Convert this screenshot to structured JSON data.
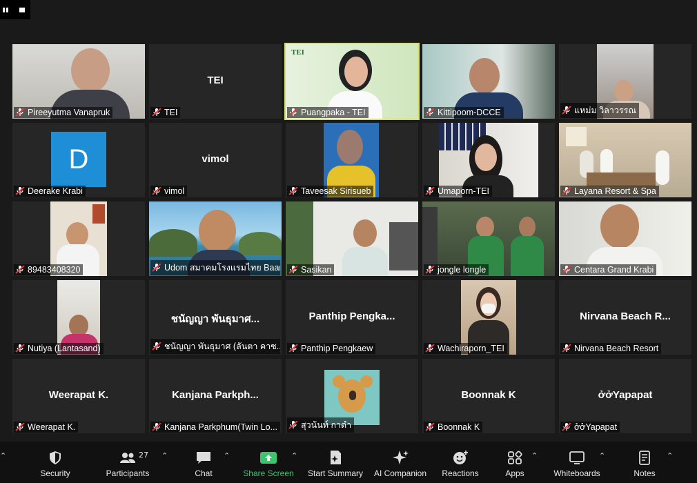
{
  "meeting": {
    "participants_count": "27"
  },
  "tiles": [
    {
      "name": "Pireeyutma Vanapruk",
      "big": "",
      "kind": "video-man-gray"
    },
    {
      "name": "TEI",
      "big": "TEI",
      "kind": "name"
    },
    {
      "name": "Puangpaka - TEI",
      "big": "",
      "kind": "video-green",
      "active": true
    },
    {
      "name": "Kittipoom-DCCE",
      "big": "",
      "kind": "video-office"
    },
    {
      "name": "แหม่ม วิลาวรรณ",
      "big": "",
      "kind": "video-room"
    },
    {
      "name": "Deerake Krabi",
      "big": "",
      "kind": "avatar"
    },
    {
      "name": "vimol",
      "big": "vimol",
      "kind": "name"
    },
    {
      "name": "Taveesak Sirisueb",
      "big": "",
      "kind": "video-blue"
    },
    {
      "name": "Umaporn-TEI",
      "big": "",
      "kind": "video-shelf"
    },
    {
      "name": "Layana Resort & Spa",
      "big": "",
      "kind": "video-meeting"
    },
    {
      "name": "89483408320",
      "big": "",
      "kind": "video-red"
    },
    {
      "name": "Udom สมาคมโรงแรมไทย Baan...",
      "big": "",
      "kind": "video-island"
    },
    {
      "name": "Sasikan",
      "big": "",
      "kind": "video-plain"
    },
    {
      "name": "jongle longle",
      "big": "",
      "kind": "video-group"
    },
    {
      "name": "Centara Grand Krabi",
      "big": "",
      "kind": "video-man"
    },
    {
      "name": "Nutiya (Lantasand)",
      "big": "",
      "kind": "video-woman"
    },
    {
      "name": "ชนัญญา พันธุมาศ (ลันตา คาซ...",
      "big": "ชนัญญา พันธุมาศ...",
      "kind": "name"
    },
    {
      "name": "Panthip Pengkaew",
      "big": "Panthip  Pengka...",
      "kind": "name"
    },
    {
      "name": "Wachiraporn_TEI",
      "big": "",
      "kind": "video-mask"
    },
    {
      "name": "Nirvana Beach Resort",
      "big": "Nirvana Beach R...",
      "kind": "name"
    },
    {
      "name": "Weerapat K.",
      "big": "Weerapat K.",
      "kind": "name"
    },
    {
      "name": "Kanjana Parkphum(Twin Lo...",
      "big": "Kanjana  Parkph...",
      "kind": "name"
    },
    {
      "name": "สุวนันท์ กาดำ",
      "big": "",
      "kind": "koala"
    },
    {
      "name": "Boonnak K",
      "big": "Boonnak K",
      "kind": "name"
    },
    {
      "name": "ởởYapapat",
      "big": "ởởYapapat",
      "kind": "name"
    }
  ],
  "toolbar": {
    "security": "Security",
    "participants": "Participants",
    "chat": "Chat",
    "share_screen": "Share Screen",
    "start_summary": "Start Summary",
    "ai_companion": "AI Companion",
    "reactions": "Reactions",
    "apps": "Apps",
    "whiteboards": "Whiteboards",
    "notes": "Notes"
  },
  "colors": {
    "background": "#1a1a1a",
    "tile": "#262626",
    "active_speaker": "#d4e06a",
    "share_green": "#3ec36f",
    "muted_red": "#e0393e",
    "avatar_blue": "#1e8fd6"
  }
}
